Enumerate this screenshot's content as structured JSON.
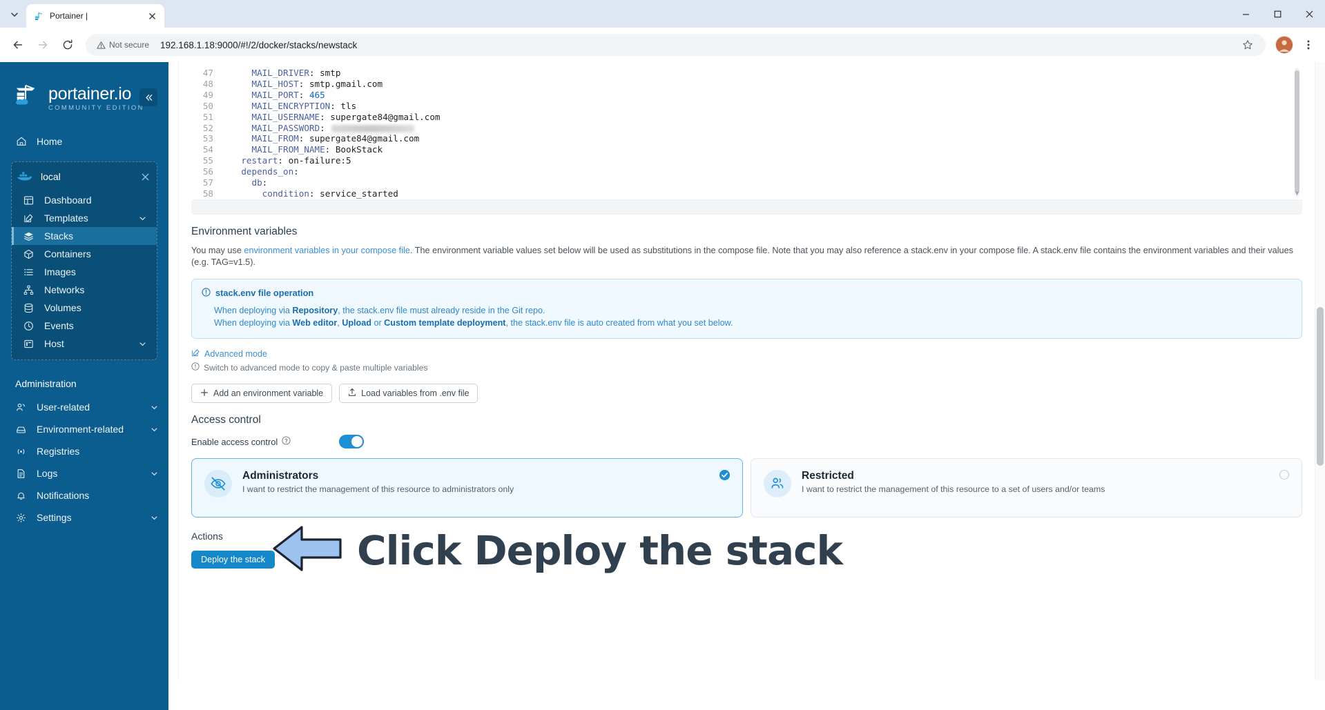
{
  "browser": {
    "tab": {
      "title": "Portainer |",
      "favicon": "portainer-icon",
      "close_icon": "close-icon"
    },
    "tab_list_icon": "chevron-down-icon",
    "window_controls": {
      "minimize": "minimize-icon",
      "maximize": "maximize-icon",
      "close": "close-icon"
    },
    "nav": {
      "back": "back-arrow-icon",
      "forward": "forward-arrow-icon",
      "reload": "reload-icon"
    },
    "omnibox": {
      "security_label": "Not secure",
      "security_icon": "warning-triangle-icon",
      "url": "192.168.1.18:9000/#!/2/docker/stacks/newstack",
      "star_icon": "star-icon"
    },
    "profile_icon": "avatar",
    "menu_icon": "kebab-menu-icon"
  },
  "sidebar": {
    "brand": {
      "name": "portainer.io",
      "subtitle": "COMMUNITY EDITION",
      "logo": "portainer-logo-icon"
    },
    "collapse_icon": "chevron-double-left-icon",
    "home": {
      "label": "Home",
      "icon": "home-icon"
    },
    "environment": {
      "name": "local",
      "icon": "docker-whale-icon",
      "close_icon": "close-icon",
      "items": [
        {
          "label": "Dashboard",
          "icon": "dashboard-icon",
          "active": false
        },
        {
          "label": "Templates",
          "icon": "template-icon",
          "active": false,
          "chevron": "chevron-down-icon"
        },
        {
          "label": "Stacks",
          "icon": "stacks-icon",
          "active": true
        },
        {
          "label": "Containers",
          "icon": "container-icon",
          "active": false
        },
        {
          "label": "Images",
          "icon": "images-icon",
          "active": false
        },
        {
          "label": "Networks",
          "icon": "networks-icon",
          "active": false
        },
        {
          "label": "Volumes",
          "icon": "volumes-icon",
          "active": false
        },
        {
          "label": "Events",
          "icon": "events-clock-icon",
          "active": false
        },
        {
          "label": "Host",
          "icon": "host-icon",
          "active": false,
          "chevron": "chevron-down-icon"
        }
      ]
    },
    "administration": {
      "title": "Administration",
      "items": [
        {
          "label": "User-related",
          "icon": "users-icon",
          "chevron": "chevron-down-icon"
        },
        {
          "label": "Environment-related",
          "icon": "environment-icon",
          "chevron": "chevron-down-icon"
        },
        {
          "label": "Registries",
          "icon": "registries-icon"
        },
        {
          "label": "Logs",
          "icon": "logs-icon",
          "chevron": "chevron-down-icon"
        },
        {
          "label": "Notifications",
          "icon": "bell-icon"
        },
        {
          "label": "Settings",
          "icon": "gear-icon",
          "chevron": "chevron-down-icon"
        }
      ]
    }
  },
  "editor": {
    "lines": [
      {
        "no": "47",
        "indent": 6,
        "key": "MAIL_DRIVER",
        "value": "smtp"
      },
      {
        "no": "48",
        "indent": 6,
        "key": "MAIL_HOST",
        "value": "smtp.gmail.com"
      },
      {
        "no": "49",
        "indent": 6,
        "key": "MAIL_PORT",
        "value": "465"
      },
      {
        "no": "50",
        "indent": 6,
        "key": "MAIL_ENCRYPTION",
        "value": "tls"
      },
      {
        "no": "51",
        "indent": 6,
        "key": "MAIL_USERNAME",
        "value": "supergate84@gmail.com"
      },
      {
        "no": "52",
        "indent": 6,
        "key": "MAIL_PASSWORD",
        "value": "",
        "redacted": true
      },
      {
        "no": "53",
        "indent": 6,
        "key": "MAIL_FROM",
        "value": "supergate84@gmail.com"
      },
      {
        "no": "54",
        "indent": 6,
        "key": "MAIL_FROM_NAME",
        "value": "BookStack"
      },
      {
        "no": "55",
        "indent": 4,
        "key": "restart",
        "value": "on-failure:5"
      },
      {
        "no": "56",
        "indent": 4,
        "key": "depends_on",
        "value": ""
      },
      {
        "no": "57",
        "indent": 6,
        "key": "db",
        "value": ""
      },
      {
        "no": "58",
        "indent": 8,
        "key": "condition",
        "value": "service_started"
      }
    ]
  },
  "env_section": {
    "title": "Environment variables",
    "paragraph_pre": "You may use ",
    "paragraph_link": "environment variables in your compose file",
    "paragraph_post": ". The environment variable values set below will be used as substitutions in the compose file. Note that you may also reference a stack.env in your compose file. A stack.env file contains the environment variables and their values (e.g. TAG=v1.5).",
    "infobox": {
      "icon": "info-circle-icon",
      "title": "stack.env file operation",
      "line1_a": "When deploying via ",
      "line1_b": "Repository",
      "line1_c": ", the stack.env file must already reside in the Git repo.",
      "line2_a": "When deploying via ",
      "line2_b": "Web editor",
      "line2_c": ", ",
      "line2_d": "Upload",
      "line2_e": " or ",
      "line2_f": "Custom template deployment",
      "line2_g": ", the stack.env file is auto created from what you set below."
    },
    "advanced_mode": {
      "label": "Advanced mode",
      "icon": "edit-square-icon"
    },
    "advanced_note": {
      "label": "Switch to advanced mode to copy & paste multiple variables",
      "icon": "info-circle-icon"
    },
    "buttons": [
      {
        "label": "Add an environment variable",
        "icon": "plus-icon"
      },
      {
        "label": "Load variables from .env file",
        "icon": "upload-icon"
      }
    ]
  },
  "access_control": {
    "title": "Access control",
    "toggle": {
      "label": "Enable access control",
      "help_icon": "question-circle-icon",
      "enabled": true
    },
    "options": [
      {
        "title": "Administrators",
        "description": "I want to restrict the management of this resource to administrators only",
        "icon": "eye-off-icon",
        "selected": true,
        "check_icon": "check-circle-icon"
      },
      {
        "title": "Restricted",
        "description": "I want to restrict the management of this resource to a set of users and/or teams",
        "icon": "users-group-icon",
        "selected": false
      }
    ]
  },
  "actions": {
    "title": "Actions",
    "deploy_label": "Deploy the stack"
  },
  "annotation": {
    "text": "Click Deploy the stack",
    "arrow_icon": "left-arrow-annotation",
    "arrow_fill": "#9dc2f0",
    "arrow_stroke": "#1b2430",
    "text_color": "#31404f"
  },
  "colors": {
    "sidebar_bg": "#0c5d8f",
    "sidebar_active": "#1b6f9e",
    "accent": "#1f8fd4",
    "deploy_btn": "#1688c9",
    "infobox_bg": "#f0f9ff",
    "infobox_border": "#bcdff5"
  }
}
